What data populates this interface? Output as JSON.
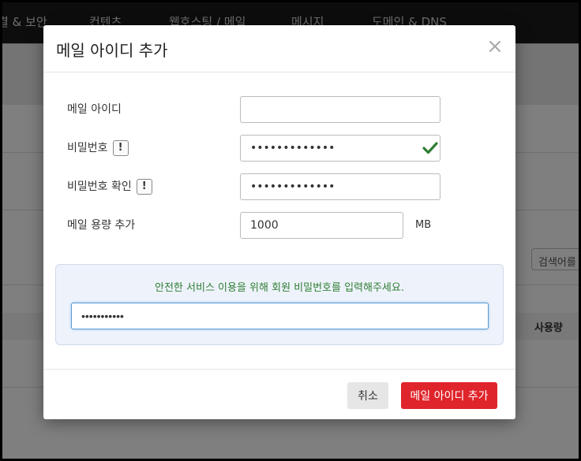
{
  "background": {
    "nav_items": [
      "결 & 보안",
      "컨텐츠",
      "웹호스팅 / 메일",
      "메시지",
      "도메인 & DNS"
    ],
    "search_button": "검색어를",
    "table_header_usage": "사용량"
  },
  "modal": {
    "title": "메일 아이디 추가",
    "close": "×",
    "fields": {
      "mail_id": {
        "label": "메일 아이디",
        "value": ""
      },
      "password": {
        "label": "비밀번호",
        "badge": "!",
        "value": "•••••••••••••"
      },
      "password_confirm": {
        "label": "비밀번호 확인",
        "badge": "!",
        "value": "•••••••••••••"
      },
      "quota": {
        "label": "메일 용량 추가",
        "value": "1000",
        "unit": "MB"
      }
    },
    "confirm": {
      "message": "안전한 서비스 이용을 위해 회원 비밀번호를 입력해주세요.",
      "value": "•••••••••••"
    },
    "buttons": {
      "cancel": "취소",
      "submit": "메일 아이디 추가"
    }
  },
  "colors": {
    "accent": "#e0242b",
    "success": "#2e7d32"
  }
}
